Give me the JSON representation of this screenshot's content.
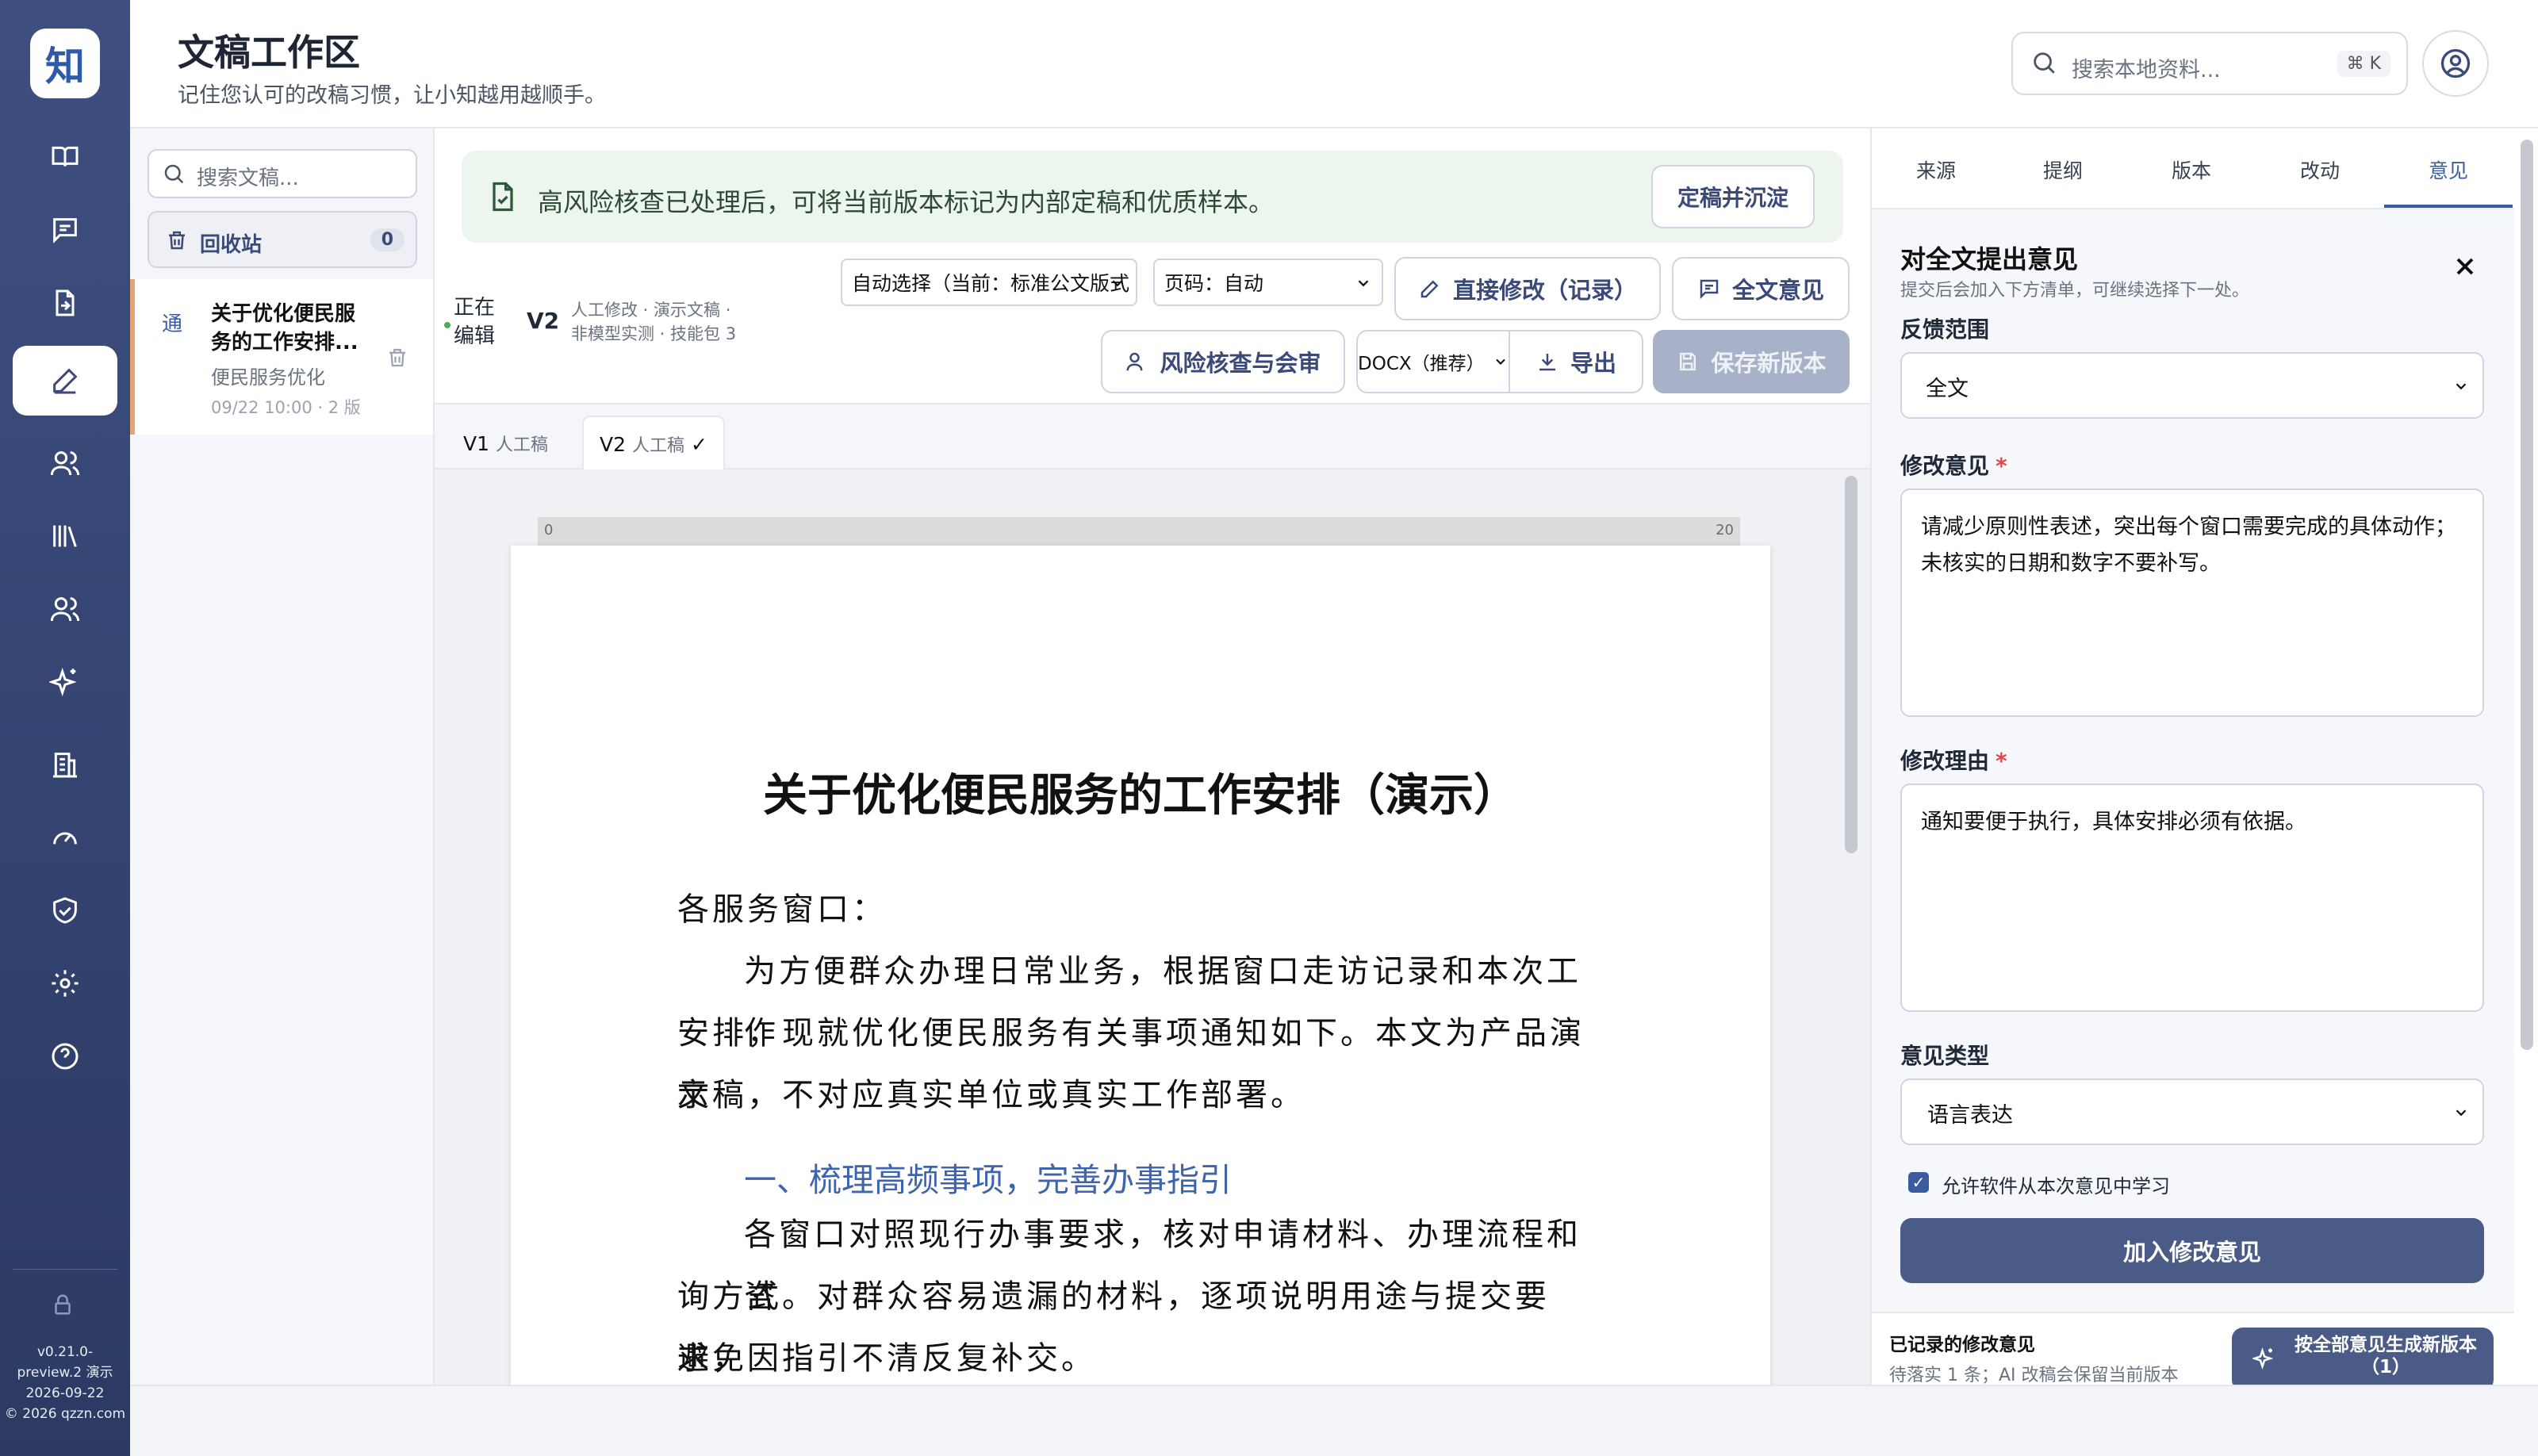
{
  "sidebar": {
    "logo": "知",
    "items": [
      {
        "icon": "book-open-icon",
        "name": "nav-library"
      },
      {
        "icon": "message-icon",
        "name": "nav-messages"
      },
      {
        "icon": "file-import-icon",
        "name": "nav-import"
      },
      {
        "icon": "pen-icon",
        "name": "nav-drafts",
        "active": true
      },
      {
        "icon": "users-icon",
        "name": "nav-people"
      },
      {
        "icon": "bookshelf-icon",
        "name": "nav-bookshelf"
      },
      {
        "icon": "group-icon",
        "name": "nav-groups"
      },
      {
        "icon": "sparkles-icon",
        "name": "nav-ai"
      },
      {
        "icon": "building-icon",
        "name": "nav-org"
      },
      {
        "icon": "gauge-icon",
        "name": "nav-dashboard"
      },
      {
        "icon": "shield-icon",
        "name": "nav-security"
      },
      {
        "icon": "gear-icon",
        "name": "nav-settings"
      },
      {
        "icon": "help-icon",
        "name": "nav-help"
      }
    ],
    "version_line1": "v0.21.0-",
    "version_line2": "preview.2 演示",
    "version_line3": "2026-09-22",
    "version_line4": "© 2026 qzzn.com"
  },
  "header": {
    "title": "文稿工作区",
    "subtitle": "记住您认可的改稿习惯，让小知越用越顺手。",
    "search_placeholder": "搜索本地资料...",
    "search_shortcut": "⌘ K"
  },
  "doclist": {
    "search_placeholder": "搜索文稿...",
    "trash_label": "回收站",
    "trash_count": "0",
    "items": [
      {
        "tag": "通",
        "title": "关于优化便民服务的工作安排...",
        "category": "便民服务优化",
        "meta": "09/22 10:00 · 2 版"
      }
    ]
  },
  "editor": {
    "banner_text": "高风险核查已处理后，可将当前版本标记为内部定稿和优质样本。",
    "finalize_label": "定稿并沉淀",
    "editing_label_1": "正在",
    "editing_label_2": "编辑",
    "version": "V2",
    "version_meta_1": "人工修改 · 演示文稿 ·",
    "version_meta_2": "非模型实测 · 技能包 3",
    "format_select": "自动选择（当前：标准公文版式",
    "page_select": "页码：自动",
    "direct_edit_label": "直接修改（记录）",
    "full_opinion_label": "全文意见",
    "risk_review_label": "风险核查与会审",
    "export_format": "DOCX（推荐）",
    "export_label": "导出",
    "save_version_label": "保存新版本",
    "tabs": [
      {
        "label": "V1",
        "sub": "人工稿"
      },
      {
        "label": "V2",
        "sub": "人工稿",
        "check": "✓"
      }
    ],
    "ruler_start": "0",
    "ruler_end": "20",
    "doc_title": "关于优化便民服务的工作安排（演示）",
    "salutation": "各服务窗口：",
    "para1_line1": "为方便群众办理日常业务，根据窗口走访记录和本次工作",
    "para1_line2": "安排，现就优化便民服务有关事项通知如下。本文为产品演示",
    "para1_line3": "文稿，不对应真实单位或真实工作部署。",
    "heading1": "一、梳理高频事项，完善办事指引",
    "para2_line1": "各窗口对照现行办事要求，核对申请材料、办理流程和咨",
    "para2_line2": "询方式。对群众容易遗漏的材料，逐项说明用途与提交要求，",
    "para2_line3": "避免因指引不清反复补交。"
  },
  "panel": {
    "tabs": [
      "来源",
      "提纲",
      "版本",
      "改动",
      "意见"
    ],
    "active_tab": "意见",
    "title": "对全文提出意见",
    "subtitle": "提交后会加入下方清单，可继续选择下一处。",
    "scope_label": "反馈范围",
    "scope_value": "全文",
    "opinion_label": "修改意见",
    "opinion_value": "请减少原则性表述，突出每个窗口需要完成的具体动作；未核实的日期和数字不要补写。",
    "reason_label": "修改理由",
    "reason_value": "通知要便于执行，具体安排必须有依据。",
    "type_label": "意见类型",
    "type_value": "语言表达",
    "learn_label": "允许软件从本次意见中学习",
    "add_label": "加入修改意见",
    "recorded_title": "已记录的修改意见",
    "recorded_sub": "待落实 1 条；AI 改稿会保留当前版本",
    "generate_label": "按全部意见生成新版本（1）"
  },
  "colors": {
    "sidebar": "#3e4f80",
    "accent": "#3b5ba0",
    "primary_button": "#4b5b87",
    "banner": "#edf6ee",
    "doc_heading": "#3d64ad"
  }
}
